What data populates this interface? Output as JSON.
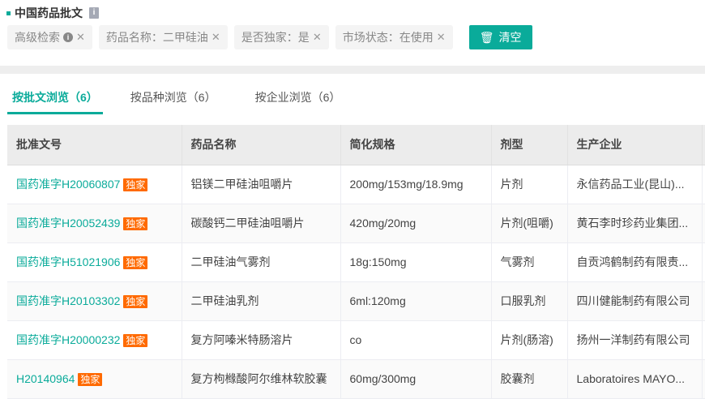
{
  "page": {
    "title": "中国药品批文"
  },
  "filters": [
    {
      "label": "高级检索",
      "has_info": true
    },
    {
      "label": "药品名称：二甲硅油"
    },
    {
      "label": "是否独家：是"
    },
    {
      "label": "市场状态：在使用"
    }
  ],
  "clear_label": "清空",
  "tabs": [
    {
      "label": "按批文浏览（6）"
    },
    {
      "label": "按品种浏览（6）"
    },
    {
      "label": "按企业浏览（6）"
    }
  ],
  "table": {
    "headers": [
      "批准文号",
      "药品名称",
      "简化规格",
      "剂型",
      "生产企业"
    ],
    "badge": "独家",
    "rows": [
      [
        "国药准字H20060807",
        "铝镁二甲硅油咀嚼片",
        "200mg/153mg/18.9mg",
        "片剂",
        "永信药品工业(昆山)..."
      ],
      [
        "国药准字H20052439",
        "碳酸钙二甲硅油咀嚼片",
        "420mg/20mg",
        "片剂(咀嚼)",
        "黄石李时珍药业集团..."
      ],
      [
        "国药准字H51021906",
        "二甲硅油气雾剂",
        "18g:150mg",
        "气雾剂",
        "自贡鸿鹤制药有限责..."
      ],
      [
        "国药准字H20103302",
        "二甲硅油乳剂",
        "6ml:120mg",
        "口服乳剂",
        "四川健能制药有限公司"
      ],
      [
        "国药准字H20000232",
        "复方阿嗪米特肠溶片",
        "co",
        "片剂(肠溶)",
        "扬州一洋制药有限公司"
      ],
      [
        "H20140964",
        "复方枸橼酸阿尔维林软胶囊",
        "60mg/300mg",
        "胶囊剂",
        "Laboratoires MAYO..."
      ]
    ]
  }
}
